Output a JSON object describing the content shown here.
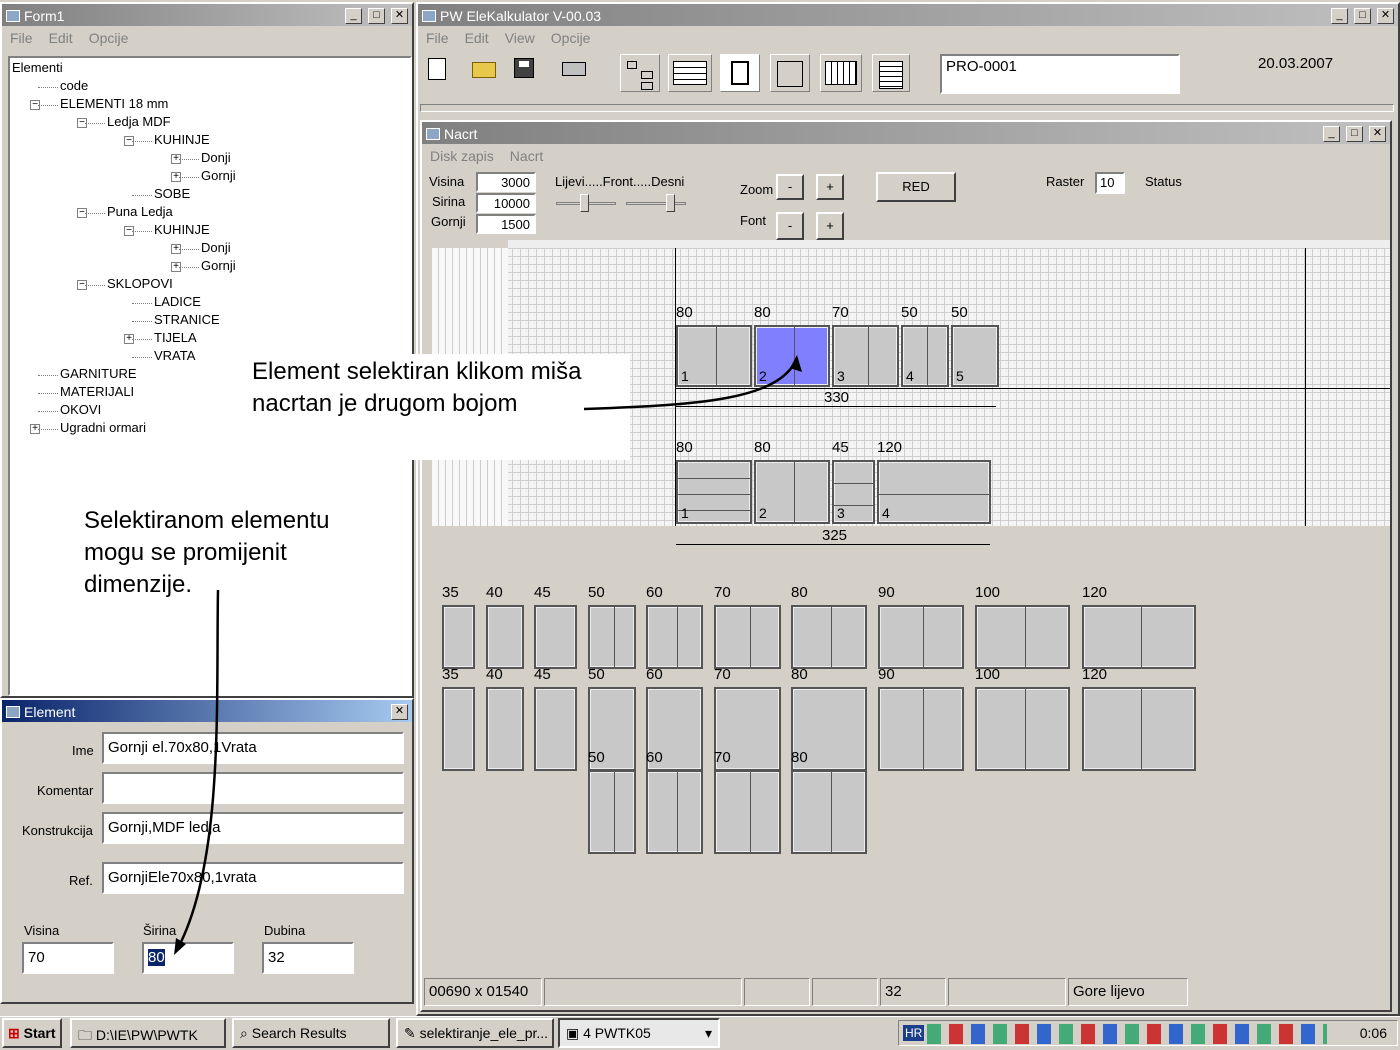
{
  "form1": {
    "title": "Form1",
    "menu": [
      "File",
      "Edit",
      "Opcije"
    ],
    "tree": [
      {
        "label": "Elementi",
        "lvl": 0,
        "exp": ""
      },
      {
        "label": "code",
        "lvl": 1,
        "exp": ""
      },
      {
        "label": "ELEMENTI 18 mm",
        "lvl": 1,
        "exp": "−"
      },
      {
        "label": "Ledja MDF",
        "lvl": 2,
        "exp": "−"
      },
      {
        "label": "KUHINJE",
        "lvl": 3,
        "exp": "−"
      },
      {
        "label": "Donji",
        "lvl": 4,
        "exp": "+"
      },
      {
        "label": "Gornji",
        "lvl": 4,
        "exp": "+"
      },
      {
        "label": "SOBE",
        "lvl": 3,
        "exp": ""
      },
      {
        "label": "Puna Ledja",
        "lvl": 2,
        "exp": "−"
      },
      {
        "label": "KUHINJE",
        "lvl": 3,
        "exp": "−"
      },
      {
        "label": "Donji",
        "lvl": 4,
        "exp": "+"
      },
      {
        "label": "Gornji",
        "lvl": 4,
        "exp": "+"
      },
      {
        "label": "SKLOPOVI",
        "lvl": 2,
        "exp": "−"
      },
      {
        "label": "LADICE",
        "lvl": 3,
        "exp": ""
      },
      {
        "label": "STRANICE",
        "lvl": 3,
        "exp": ""
      },
      {
        "label": "TIJELA",
        "lvl": 3,
        "exp": "+"
      },
      {
        "label": "VRATA",
        "lvl": 3,
        "exp": ""
      },
      {
        "label": "GARNITURE",
        "lvl": 1,
        "exp": ""
      },
      {
        "label": "MATERIJALI",
        "lvl": 1,
        "exp": ""
      },
      {
        "label": "OKOVI",
        "lvl": 1,
        "exp": ""
      },
      {
        "label": "Ugradni ormari",
        "lvl": 1,
        "exp": "+"
      }
    ]
  },
  "main": {
    "title": "PW EleKalkulator V-00.03",
    "menu": [
      "File",
      "Edit",
      "View",
      "Opcije"
    ],
    "project": "PRO-0001",
    "date": "20.03.2007"
  },
  "nacrt": {
    "title": "Nacrt",
    "menu": [
      "Disk zapis",
      "Nacrt"
    ],
    "visina_label": "Visina",
    "visina": "3000",
    "sirina_label": "Sirina",
    "sirina": "10000",
    "gornji_label": "Gornji",
    "gornji": "1500",
    "slider_label": "Lijevi.....Front.....Desni",
    "zoom_label": "Zoom",
    "font_label": "Font",
    "minus": "-",
    "plus": "+",
    "red": "RED",
    "raster_label": "Raster",
    "raster": "10",
    "status_label": "Status",
    "upper_row": {
      "total": "330",
      "items": [
        {
          "w": "80",
          "n": "1"
        },
        {
          "w": "80",
          "n": "2"
        },
        {
          "w": "70",
          "n": "3"
        },
        {
          "w": "50",
          "n": "4"
        },
        {
          "w": "50",
          "n": "5"
        }
      ]
    },
    "lower_row": {
      "total": "325",
      "items": [
        {
          "w": "80",
          "n": "1"
        },
        {
          "w": "80",
          "n": "2"
        },
        {
          "w": "45",
          "n": "3"
        },
        {
          "w": "120",
          "n": "4"
        }
      ]
    },
    "palette_row1": [
      "35",
      "40",
      "45",
      "50",
      "60",
      "70",
      "80",
      "90",
      "100",
      "120"
    ],
    "palette_row2": [
      "35",
      "40",
      "45",
      "50",
      "60",
      "70",
      "80",
      "90",
      "100",
      "120"
    ],
    "palette_row3": [
      "50",
      "60",
      "70",
      "80"
    ],
    "statusbar": {
      "size": "00690 x 01540",
      "depth": "32",
      "pos": "Gore lijevo"
    }
  },
  "element": {
    "title": "Element",
    "ime_label": "Ime",
    "ime": "Gornji el.70x80,1Vrata",
    "komentar_label": "Komentar",
    "komentar": "",
    "konstrukcija_label": "Konstrukcija",
    "konstrukcija": "Gornji,MDF ledja",
    "ref_label": "Ref.",
    "ref": "GornjiEle70x80,1vrata",
    "visina_label": "Visina",
    "visina": "70",
    "sirina_label": "Širina",
    "sirina": "80",
    "dubina_label": "Dubina",
    "dubina": "32"
  },
  "annotations": {
    "a1_line1": "Element selektiran klikom miša",
    "a1_line2": "nacrtan je drugom bojom",
    "a2_line1": "Selektiranom elementu",
    "a2_line2": "mogu se promijenit",
    "a2_line3": "dimenzije."
  },
  "taskbar": {
    "start": "Start",
    "items": [
      "D:\\IE\\PW\\PWTK",
      "Search Results",
      "selektiranje_ele_pr...",
      "4 PWTK05"
    ],
    "clock": "0:06",
    "lang": "HR"
  }
}
